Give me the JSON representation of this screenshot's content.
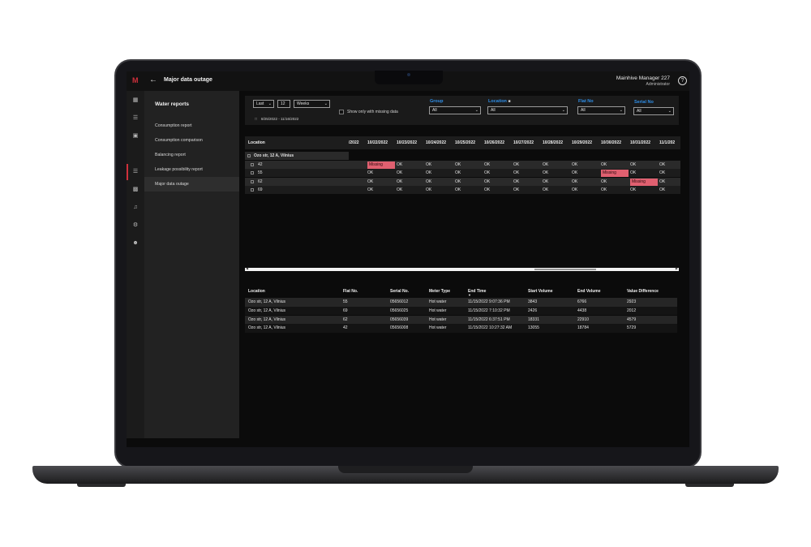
{
  "header": {
    "logo": "M",
    "back_icon": "arrow-left-icon",
    "title": "Major data outage",
    "user_name": "Mainhive Manager 227",
    "user_role": "Administrator",
    "help_icon": "question-circle-icon"
  },
  "icon_rail": [
    "dashboard-icon",
    "list-icon",
    "image-icon",
    "reports-icon",
    "map-icon",
    "bell-icon",
    "settings-icon",
    "user-icon"
  ],
  "sidebar": {
    "title": "Water reports",
    "items": [
      {
        "label": "Consumption report"
      },
      {
        "label": "Consumption comparison"
      },
      {
        "label": "Balancing report"
      },
      {
        "label": "Leakage possibility report"
      },
      {
        "label": "Major data outage"
      }
    ]
  },
  "filters": {
    "range_mode": "Last",
    "range_count": "12",
    "range_unit": "Weeks",
    "show_missing_label": "Show only with missing data",
    "date_range": "8/25/2022 - 11/16/2022",
    "group": {
      "label": "Group",
      "value": "All"
    },
    "location": {
      "label": "Location",
      "value": "All"
    },
    "flat_no": {
      "label": "Flat No",
      "value": "All"
    },
    "serial_no": {
      "label": "Serial No",
      "value": "All"
    }
  },
  "matrix": {
    "location_header": "Location",
    "dates": [
      "/2022",
      "10/22/2022",
      "10/23/2022",
      "10/24/2022",
      "10/25/2022",
      "10/26/2022",
      "10/27/2022",
      "10/28/2022",
      "10/29/2022",
      "10/30/2022",
      "10/31/2022",
      "11/1/202"
    ],
    "group_label": "Ozo str, 12 A, Vilnius",
    "rows": [
      {
        "flat": "42",
        "cells": [
          "Missing",
          "OK",
          "OK",
          "OK",
          "OK",
          "OK",
          "OK",
          "OK",
          "OK",
          "OK",
          "OK"
        ]
      },
      {
        "flat": "55",
        "cells": [
          "OK",
          "OK",
          "OK",
          "OK",
          "OK",
          "OK",
          "OK",
          "OK",
          "Missing",
          "OK",
          "OK"
        ]
      },
      {
        "flat": "62",
        "cells": [
          "OK",
          "OK",
          "OK",
          "OK",
          "OK",
          "OK",
          "OK",
          "OK",
          "OK",
          "Missing",
          "OK"
        ]
      },
      {
        "flat": "69",
        "cells": [
          "OK",
          "OK",
          "OK",
          "OK",
          "OK",
          "OK",
          "OK",
          "OK",
          "OK",
          "OK",
          "OK"
        ]
      }
    ]
  },
  "details": {
    "headers": [
      "Location",
      "Flat No.",
      "Serial No.",
      "Meter Type",
      "End Time",
      "Start Volume",
      "End Volume",
      "Value Difference"
    ],
    "rows": [
      [
        "Ozo str, 12 A, Vilnius",
        "55",
        "05656012",
        "Hot water",
        "11/15/2022 9:07:36 PM",
        "3843",
        "6766",
        "2923"
      ],
      [
        "Ozo str, 12 A, Vilnius",
        "69",
        "05656025",
        "Hot water",
        "11/15/2022 7:10:32 PM",
        "2426",
        "4438",
        "2012"
      ],
      [
        "Ozo str, 12 A, Vilnius",
        "62",
        "05656039",
        "Hot water",
        "11/15/2022 6:37:51 PM",
        "18331",
        "22910",
        "4579"
      ],
      [
        "Ozo str, 12 A, Vilnius",
        "42",
        "05656008",
        "Hot water",
        "11/15/2022 10:27:32 AM",
        "13055",
        "18784",
        "5729"
      ]
    ]
  },
  "colors": {
    "accent_red": "#d0303c",
    "missing_bg": "#e06070",
    "filter_label_blue": "#2f8fe8"
  }
}
